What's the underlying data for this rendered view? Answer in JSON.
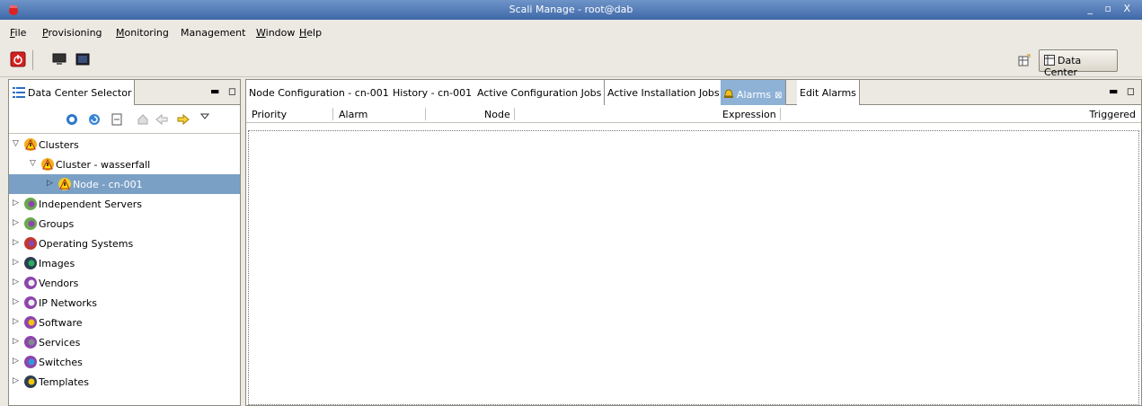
{
  "window": {
    "title": "Scali Manage - root@dab",
    "controls": "_ ▫ X"
  },
  "menu": [
    {
      "label": "File",
      "mn": "F",
      "rest": "ile"
    },
    {
      "label": "Provisioning",
      "mn": "P",
      "rest": "rovisioning"
    },
    {
      "label": "Monitoring",
      "mn": "M",
      "rest": "onitoring"
    },
    {
      "label": "Management",
      "mn": "",
      "rest": "Management"
    },
    {
      "label": "Window",
      "mn": "W",
      "rest": "indow"
    },
    {
      "label": "Help",
      "mn": "H",
      "rest": "elp"
    }
  ],
  "perspective": {
    "label": "Data Center"
  },
  "left_panel": {
    "tab_label": "Data Center Selector",
    "tree": [
      {
        "label": "Clusters",
        "depth": 0,
        "expanded": true,
        "selected": false,
        "icon": "warning-cluster"
      },
      {
        "label": "Cluster - wasserfall",
        "depth": 1,
        "expanded": true,
        "selected": false,
        "icon": "warning-cluster"
      },
      {
        "label": "Node - cn-001",
        "depth": 2,
        "expanded": false,
        "selected": true,
        "icon": "warning-node"
      },
      {
        "label": "Independent Servers",
        "depth": 0,
        "expanded": false,
        "selected": false,
        "icon": "servers"
      },
      {
        "label": "Groups",
        "depth": 0,
        "expanded": false,
        "selected": false,
        "icon": "groups"
      },
      {
        "label": "Operating Systems",
        "depth": 0,
        "expanded": false,
        "selected": false,
        "icon": "os"
      },
      {
        "label": "Images",
        "depth": 0,
        "expanded": false,
        "selected": false,
        "icon": "images"
      },
      {
        "label": "Vendors",
        "depth": 0,
        "expanded": false,
        "selected": false,
        "icon": "vendors"
      },
      {
        "label": "IP Networks",
        "depth": 0,
        "expanded": false,
        "selected": false,
        "icon": "networks"
      },
      {
        "label": "Software",
        "depth": 0,
        "expanded": false,
        "selected": false,
        "icon": "software"
      },
      {
        "label": "Services",
        "depth": 0,
        "expanded": false,
        "selected": false,
        "icon": "services"
      },
      {
        "label": "Switches",
        "depth": 0,
        "expanded": false,
        "selected": false,
        "icon": "switches"
      },
      {
        "label": "Templates",
        "depth": 0,
        "expanded": false,
        "selected": false,
        "icon": "templates"
      }
    ]
  },
  "right_panel": {
    "tabs": [
      {
        "label": "Node Configuration - cn-001",
        "active": false
      },
      {
        "label": "History - cn-001",
        "active": false
      },
      {
        "label": "Active Configuration Jobs",
        "active": false
      },
      {
        "label": "Active Installation Jobs",
        "active": false
      },
      {
        "label": "Alarms",
        "active": true
      },
      {
        "label": "Edit Alarms",
        "active": false
      }
    ],
    "columns": [
      "Priority",
      "Alarm",
      "Node",
      "Expression",
      "Triggered"
    ]
  },
  "colors": {
    "titlebar": "#4a74b3",
    "selection": "#7aa0c5",
    "active_tab": "#8eb1d6"
  }
}
